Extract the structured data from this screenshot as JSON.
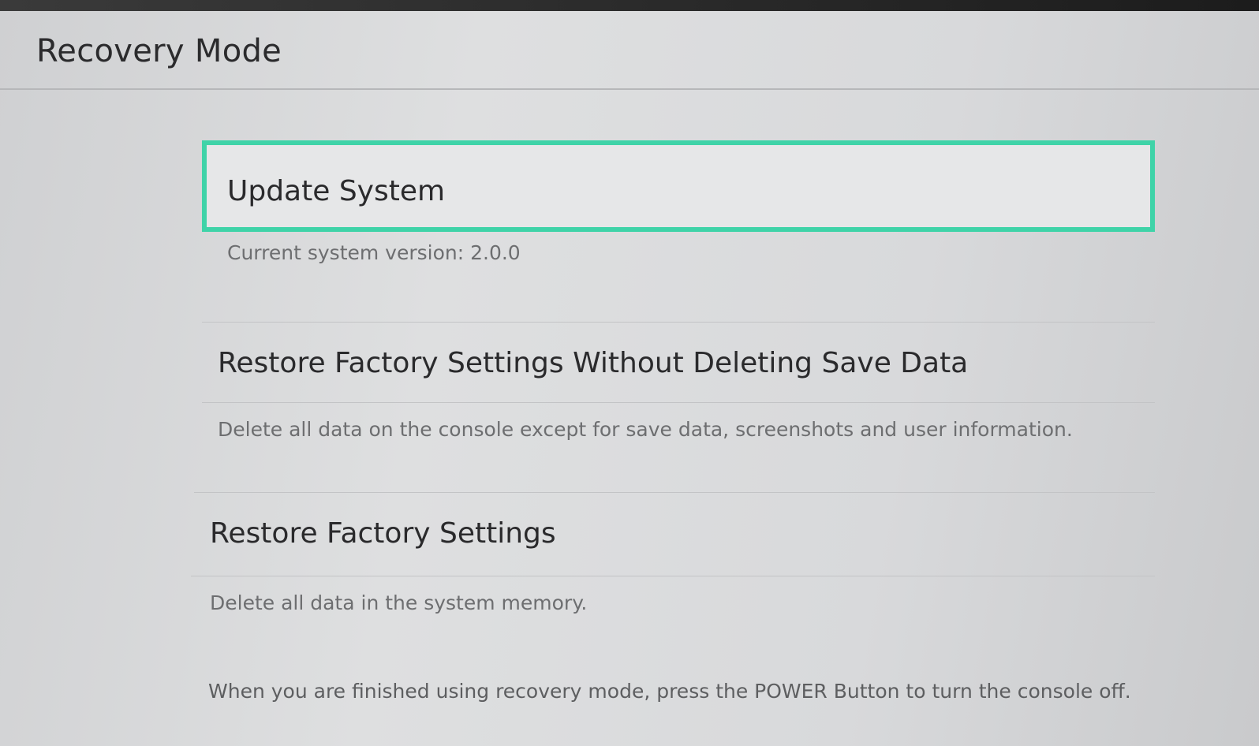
{
  "header": {
    "title": "Recovery Mode"
  },
  "menu": {
    "items": [
      {
        "label": "Update System",
        "description": "Current system version: 2.0.0",
        "selected": true
      },
      {
        "label": "Restore Factory Settings Without Deleting Save Data",
        "description": "Delete all data on the console except for save data, screenshots and user information.",
        "selected": false
      },
      {
        "label": "Restore Factory Settings",
        "description": "Delete all data in the system memory.",
        "selected": false
      }
    ]
  },
  "footer": {
    "note": "When you are finished using recovery mode, press the POWER Button to turn the console off."
  },
  "colors": {
    "selection_accent": "#3fd3a8",
    "background": "#dcdde0",
    "text_primary": "#2b2b2d",
    "text_secondary": "#6d6e70"
  }
}
